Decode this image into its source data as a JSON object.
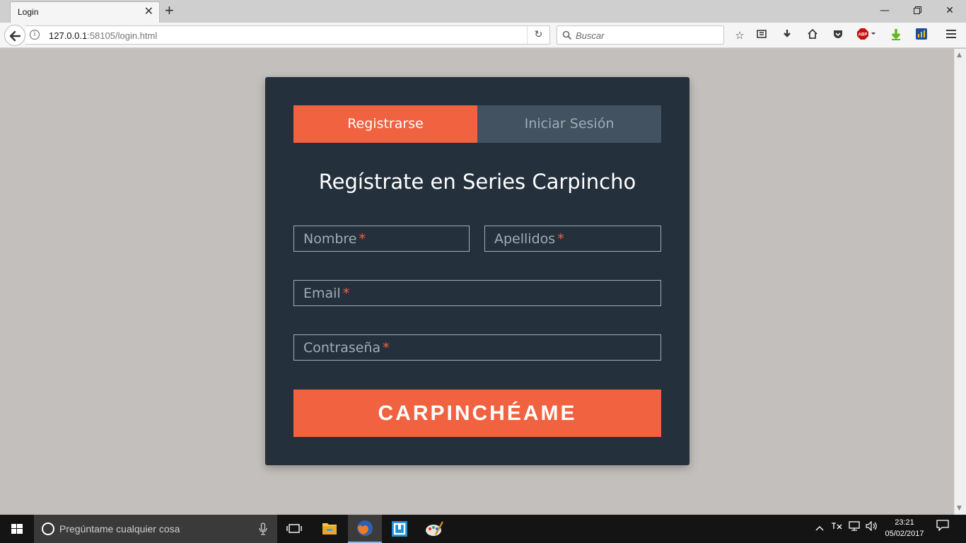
{
  "browser": {
    "tab_title": "Login",
    "new_tab": "+",
    "url_host": "127.0.0.1",
    "url_rest": ":58105/login.html",
    "search_placeholder": "Buscar",
    "adblock_label": "ABP"
  },
  "page": {
    "tabs": [
      {
        "label": "Registrarse",
        "active": true
      },
      {
        "label": "Iniciar Sesión",
        "active": false
      }
    ],
    "title": "Regístrate en Series Carpincho",
    "fields": {
      "nombre": "Nombre",
      "apellidos": "Apellidos",
      "email": "Email",
      "password": "Contraseña",
      "required_mark": "*"
    },
    "submit_label": "CARPINCHÉAME"
  },
  "taskbar": {
    "search_placeholder": "Pregúntame cualquier cosa",
    "time": "23:21",
    "date": "05/02/2017"
  },
  "colors": {
    "accent": "#f06240",
    "card_bg": "#24303c",
    "inactive_tab": "#435260",
    "page_bg": "#c3bfbc"
  }
}
